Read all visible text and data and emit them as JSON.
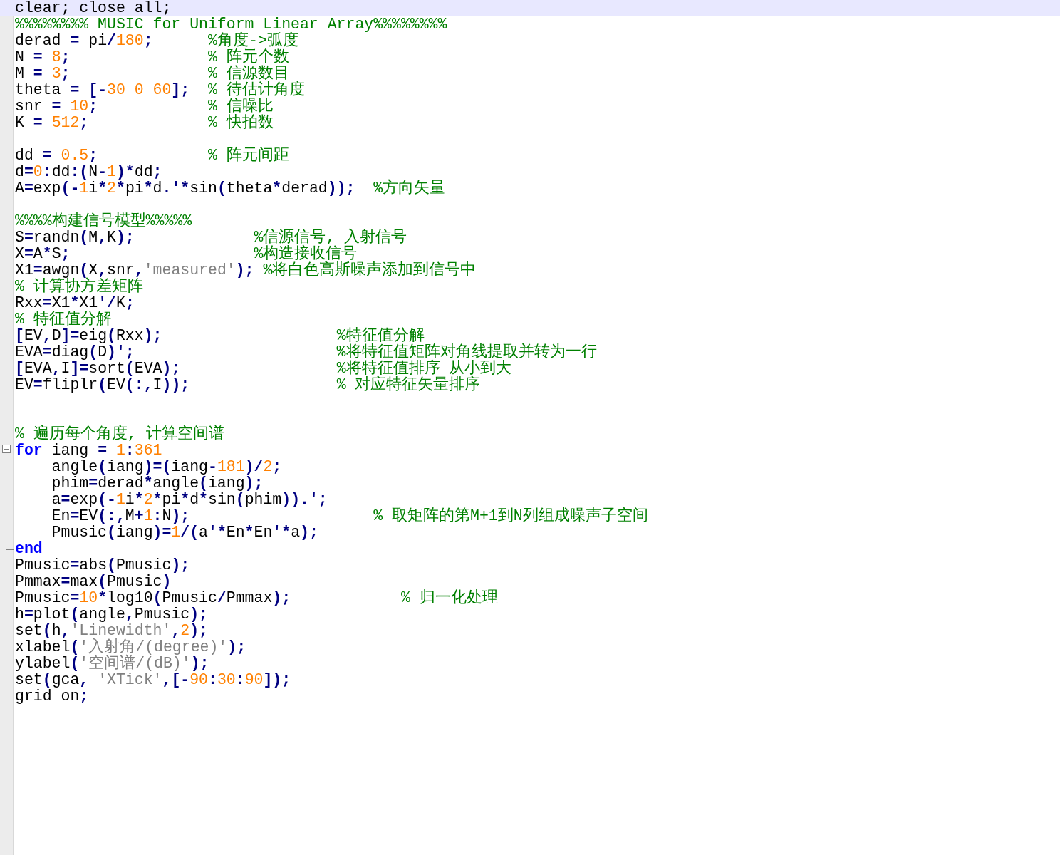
{
  "editor": {
    "lines": [
      {
        "current": true,
        "tokens": [
          {
            "kind": "plain",
            "text": "clear; close all;"
          }
        ]
      },
      {
        "current": false,
        "tokens": [
          {
            "kind": "comment",
            "text": "%%%%%%%% MUSIC for Uniform Linear Array%%%%%%%%"
          }
        ]
      },
      {
        "current": false,
        "tokens": [
          {
            "kind": "plain",
            "text": "derad "
          },
          {
            "kind": "op",
            "text": "="
          },
          {
            "kind": "plain",
            "text": " pi"
          },
          {
            "kind": "op",
            "text": "/"
          },
          {
            "kind": "num",
            "text": "180"
          },
          {
            "kind": "op",
            "text": ";      "
          },
          {
            "kind": "comment",
            "text": "%角度->弧度"
          }
        ]
      },
      {
        "current": false,
        "tokens": [
          {
            "kind": "plain",
            "text": "N "
          },
          {
            "kind": "op",
            "text": "= "
          },
          {
            "kind": "num",
            "text": "8"
          },
          {
            "kind": "op",
            "text": ";               "
          },
          {
            "kind": "comment",
            "text": "% 阵元个数"
          }
        ]
      },
      {
        "current": false,
        "tokens": [
          {
            "kind": "plain",
            "text": "M "
          },
          {
            "kind": "op",
            "text": "= "
          },
          {
            "kind": "num",
            "text": "3"
          },
          {
            "kind": "op",
            "text": ";               "
          },
          {
            "kind": "comment",
            "text": "% 信源数目"
          }
        ]
      },
      {
        "current": false,
        "tokens": [
          {
            "kind": "plain",
            "text": "theta "
          },
          {
            "kind": "op",
            "text": "= [-"
          },
          {
            "kind": "num",
            "text": "30 0 60"
          },
          {
            "kind": "op",
            "text": "];  "
          },
          {
            "kind": "comment",
            "text": "% 待估计角度"
          }
        ]
      },
      {
        "current": false,
        "tokens": [
          {
            "kind": "plain",
            "text": "snr "
          },
          {
            "kind": "op",
            "text": "= "
          },
          {
            "kind": "num",
            "text": "10"
          },
          {
            "kind": "op",
            "text": ";            "
          },
          {
            "kind": "comment",
            "text": "% 信噪比"
          }
        ]
      },
      {
        "current": false,
        "tokens": [
          {
            "kind": "plain",
            "text": "K "
          },
          {
            "kind": "op",
            "text": "= "
          },
          {
            "kind": "num",
            "text": "512"
          },
          {
            "kind": "op",
            "text": ";             "
          },
          {
            "kind": "comment",
            "text": "% 快拍数"
          }
        ]
      },
      {
        "current": false,
        "kind": "blank"
      },
      {
        "current": false,
        "tokens": [
          {
            "kind": "plain",
            "text": "dd "
          },
          {
            "kind": "op",
            "text": "= "
          },
          {
            "kind": "num",
            "text": "0.5"
          },
          {
            "kind": "op",
            "text": ";            "
          },
          {
            "kind": "comment",
            "text": "% 阵元间距"
          }
        ]
      },
      {
        "current": false,
        "tokens": [
          {
            "kind": "plain",
            "text": "d"
          },
          {
            "kind": "op",
            "text": "="
          },
          {
            "kind": "num",
            "text": "0"
          },
          {
            "kind": "op",
            "text": ":"
          },
          {
            "kind": "plain",
            "text": "dd"
          },
          {
            "kind": "op",
            "text": ":("
          },
          {
            "kind": "plain",
            "text": "N"
          },
          {
            "kind": "op",
            "text": "-"
          },
          {
            "kind": "num",
            "text": "1"
          },
          {
            "kind": "op",
            "text": ")*"
          },
          {
            "kind": "plain",
            "text": "dd"
          },
          {
            "kind": "op",
            "text": ";"
          }
        ]
      },
      {
        "current": false,
        "tokens": [
          {
            "kind": "plain",
            "text": "A"
          },
          {
            "kind": "op",
            "text": "="
          },
          {
            "kind": "plain",
            "text": "exp"
          },
          {
            "kind": "op",
            "text": "(-"
          },
          {
            "kind": "num",
            "text": "1"
          },
          {
            "kind": "plain",
            "text": "i"
          },
          {
            "kind": "op",
            "text": "*"
          },
          {
            "kind": "num",
            "text": "2"
          },
          {
            "kind": "op",
            "text": "*"
          },
          {
            "kind": "plain",
            "text": "pi"
          },
          {
            "kind": "op",
            "text": "*"
          },
          {
            "kind": "plain",
            "text": "d"
          },
          {
            "kind": "op",
            "text": ".'*"
          },
          {
            "kind": "plain",
            "text": "sin"
          },
          {
            "kind": "op",
            "text": "("
          },
          {
            "kind": "plain",
            "text": "theta"
          },
          {
            "kind": "op",
            "text": "*"
          },
          {
            "kind": "plain",
            "text": "derad"
          },
          {
            "kind": "op",
            "text": "));  "
          },
          {
            "kind": "comment",
            "text": "%方向矢量"
          }
        ]
      },
      {
        "current": false,
        "kind": "blank"
      },
      {
        "current": false,
        "tokens": [
          {
            "kind": "comment",
            "text": "%%%%构建信号模型%%%%%"
          }
        ]
      },
      {
        "current": false,
        "tokens": [
          {
            "kind": "plain",
            "text": "S"
          },
          {
            "kind": "op",
            "text": "="
          },
          {
            "kind": "plain",
            "text": "randn"
          },
          {
            "kind": "op",
            "text": "("
          },
          {
            "kind": "plain",
            "text": "M"
          },
          {
            "kind": "op",
            "text": ","
          },
          {
            "kind": "plain",
            "text": "K"
          },
          {
            "kind": "op",
            "text": ");             "
          },
          {
            "kind": "comment",
            "text": "%信源信号, 入射信号"
          }
        ]
      },
      {
        "current": false,
        "tokens": [
          {
            "kind": "plain",
            "text": "X"
          },
          {
            "kind": "op",
            "text": "="
          },
          {
            "kind": "plain",
            "text": "A"
          },
          {
            "kind": "op",
            "text": "*"
          },
          {
            "kind": "plain",
            "text": "S"
          },
          {
            "kind": "op",
            "text": ";                    "
          },
          {
            "kind": "comment",
            "text": "%构造接收信号"
          }
        ]
      },
      {
        "current": false,
        "tokens": [
          {
            "kind": "plain",
            "text": "X1"
          },
          {
            "kind": "op",
            "text": "="
          },
          {
            "kind": "plain",
            "text": "awgn"
          },
          {
            "kind": "op",
            "text": "("
          },
          {
            "kind": "plain",
            "text": "X"
          },
          {
            "kind": "op",
            "text": ","
          },
          {
            "kind": "plain",
            "text": "snr"
          },
          {
            "kind": "op",
            "text": ","
          },
          {
            "kind": "string",
            "text": "'measured'"
          },
          {
            "kind": "op",
            "text": "); "
          },
          {
            "kind": "comment",
            "text": "%将白色高斯噪声添加到信号中"
          }
        ]
      },
      {
        "current": false,
        "tokens": [
          {
            "kind": "comment",
            "text": "% 计算协方差矩阵"
          }
        ]
      },
      {
        "current": false,
        "tokens": [
          {
            "kind": "plain",
            "text": "Rxx"
          },
          {
            "kind": "op",
            "text": "="
          },
          {
            "kind": "plain",
            "text": "X1"
          },
          {
            "kind": "op",
            "text": "*"
          },
          {
            "kind": "plain",
            "text": "X1"
          },
          {
            "kind": "op",
            "text": "'/"
          },
          {
            "kind": "plain",
            "text": "K"
          },
          {
            "kind": "op",
            "text": ";"
          }
        ]
      },
      {
        "current": false,
        "tokens": [
          {
            "kind": "comment",
            "text": "% 特征值分解"
          }
        ]
      },
      {
        "current": false,
        "tokens": [
          {
            "kind": "op",
            "text": "["
          },
          {
            "kind": "plain",
            "text": "EV"
          },
          {
            "kind": "op",
            "text": ","
          },
          {
            "kind": "plain",
            "text": "D"
          },
          {
            "kind": "op",
            "text": "]="
          },
          {
            "kind": "plain",
            "text": "eig"
          },
          {
            "kind": "op",
            "text": "("
          },
          {
            "kind": "plain",
            "text": "Rxx"
          },
          {
            "kind": "op",
            "text": ");                   "
          },
          {
            "kind": "comment",
            "text": "%特征值分解"
          }
        ]
      },
      {
        "current": false,
        "tokens": [
          {
            "kind": "plain",
            "text": "EVA"
          },
          {
            "kind": "op",
            "text": "="
          },
          {
            "kind": "plain",
            "text": "diag"
          },
          {
            "kind": "op",
            "text": "("
          },
          {
            "kind": "plain",
            "text": "D"
          },
          {
            "kind": "op",
            "text": ")';                      "
          },
          {
            "kind": "comment",
            "text": "%将特征值矩阵对角线提取并转为一行"
          }
        ]
      },
      {
        "current": false,
        "tokens": [
          {
            "kind": "op",
            "text": "["
          },
          {
            "kind": "plain",
            "text": "EVA"
          },
          {
            "kind": "op",
            "text": ","
          },
          {
            "kind": "plain",
            "text": "I"
          },
          {
            "kind": "op",
            "text": "]="
          },
          {
            "kind": "plain",
            "text": "sort"
          },
          {
            "kind": "op",
            "text": "("
          },
          {
            "kind": "plain",
            "text": "EVA"
          },
          {
            "kind": "op",
            "text": ");                 "
          },
          {
            "kind": "comment",
            "text": "%将特征值排序 从小到大"
          }
        ]
      },
      {
        "current": false,
        "tokens": [
          {
            "kind": "plain",
            "text": "EV"
          },
          {
            "kind": "op",
            "text": "="
          },
          {
            "kind": "plain",
            "text": "fliplr"
          },
          {
            "kind": "op",
            "text": "("
          },
          {
            "kind": "plain",
            "text": "EV"
          },
          {
            "kind": "op",
            "text": "(:,"
          },
          {
            "kind": "plain",
            "text": "I"
          },
          {
            "kind": "op",
            "text": "));                "
          },
          {
            "kind": "comment",
            "text": "% 对应特征矢量排序"
          }
        ]
      },
      {
        "current": false,
        "kind": "blank"
      },
      {
        "current": false,
        "kind": "blank"
      },
      {
        "current": false,
        "tokens": [
          {
            "kind": "comment",
            "text": "% 遍历每个角度, 计算空间谱"
          }
        ]
      },
      {
        "current": false,
        "kind": "fold_start",
        "tokens": [
          {
            "kind": "keyword",
            "text": "for"
          },
          {
            "kind": "plain",
            "text": " iang "
          },
          {
            "kind": "op",
            "text": "= "
          },
          {
            "kind": "num",
            "text": "1"
          },
          {
            "kind": "op",
            "text": ":"
          },
          {
            "kind": "num",
            "text": "361"
          }
        ]
      },
      {
        "current": false,
        "kind": "fold_body",
        "tokens": [
          {
            "kind": "plain",
            "text": "    angle"
          },
          {
            "kind": "op",
            "text": "("
          },
          {
            "kind": "plain",
            "text": "iang"
          },
          {
            "kind": "op",
            "text": ")=("
          },
          {
            "kind": "plain",
            "text": "iang"
          },
          {
            "kind": "op",
            "text": "-"
          },
          {
            "kind": "num",
            "text": "181"
          },
          {
            "kind": "op",
            "text": ")/"
          },
          {
            "kind": "num",
            "text": "2"
          },
          {
            "kind": "op",
            "text": ";"
          }
        ]
      },
      {
        "current": false,
        "kind": "fold_body",
        "tokens": [
          {
            "kind": "plain",
            "text": "    phim"
          },
          {
            "kind": "op",
            "text": "="
          },
          {
            "kind": "plain",
            "text": "derad"
          },
          {
            "kind": "op",
            "text": "*"
          },
          {
            "kind": "plain",
            "text": "angle"
          },
          {
            "kind": "op",
            "text": "("
          },
          {
            "kind": "plain",
            "text": "iang"
          },
          {
            "kind": "op",
            "text": ");"
          }
        ]
      },
      {
        "current": false,
        "kind": "fold_body",
        "tokens": [
          {
            "kind": "plain",
            "text": "    a"
          },
          {
            "kind": "op",
            "text": "="
          },
          {
            "kind": "plain",
            "text": "exp"
          },
          {
            "kind": "op",
            "text": "(-"
          },
          {
            "kind": "num",
            "text": "1"
          },
          {
            "kind": "plain",
            "text": "i"
          },
          {
            "kind": "op",
            "text": "*"
          },
          {
            "kind": "num",
            "text": "2"
          },
          {
            "kind": "op",
            "text": "*"
          },
          {
            "kind": "plain",
            "text": "pi"
          },
          {
            "kind": "op",
            "text": "*"
          },
          {
            "kind": "plain",
            "text": "d"
          },
          {
            "kind": "op",
            "text": "*"
          },
          {
            "kind": "plain",
            "text": "sin"
          },
          {
            "kind": "op",
            "text": "("
          },
          {
            "kind": "plain",
            "text": "phim"
          },
          {
            "kind": "op",
            "text": ")).';"
          }
        ]
      },
      {
        "current": false,
        "kind": "fold_body",
        "tokens": [
          {
            "kind": "plain",
            "text": "    En"
          },
          {
            "kind": "op",
            "text": "="
          },
          {
            "kind": "plain",
            "text": "EV"
          },
          {
            "kind": "op",
            "text": "(:,"
          },
          {
            "kind": "plain",
            "text": "M"
          },
          {
            "kind": "op",
            "text": "+"
          },
          {
            "kind": "num",
            "text": "1"
          },
          {
            "kind": "op",
            "text": ":"
          },
          {
            "kind": "plain",
            "text": "N"
          },
          {
            "kind": "op",
            "text": ");                    "
          },
          {
            "kind": "comment",
            "text": "% 取矩阵的第M+1到N列组成噪声子空间"
          }
        ]
      },
      {
        "current": false,
        "kind": "fold_body",
        "tokens": [
          {
            "kind": "plain",
            "text": "    Pmusic"
          },
          {
            "kind": "op",
            "text": "("
          },
          {
            "kind": "plain",
            "text": "iang"
          },
          {
            "kind": "op",
            "text": ")="
          },
          {
            "kind": "num",
            "text": "1"
          },
          {
            "kind": "op",
            "text": "/("
          },
          {
            "kind": "plain",
            "text": "a"
          },
          {
            "kind": "op",
            "text": "'*"
          },
          {
            "kind": "plain",
            "text": "En"
          },
          {
            "kind": "op",
            "text": "*"
          },
          {
            "kind": "plain",
            "text": "En"
          },
          {
            "kind": "op",
            "text": "'*"
          },
          {
            "kind": "plain",
            "text": "a"
          },
          {
            "kind": "op",
            "text": ");"
          }
        ]
      },
      {
        "current": false,
        "kind": "fold_end",
        "tokens": [
          {
            "kind": "keyword",
            "text": "end"
          }
        ]
      },
      {
        "current": false,
        "tokens": [
          {
            "kind": "plain",
            "text": "Pmusic"
          },
          {
            "kind": "op",
            "text": "="
          },
          {
            "kind": "plain",
            "text": "abs"
          },
          {
            "kind": "op",
            "text": "("
          },
          {
            "kind": "plain",
            "text": "Pmusic"
          },
          {
            "kind": "op",
            "text": ");"
          }
        ]
      },
      {
        "current": false,
        "tokens": [
          {
            "kind": "plain",
            "text": "Pmmax"
          },
          {
            "kind": "op",
            "text": "="
          },
          {
            "kind": "plain",
            "text": "max"
          },
          {
            "kind": "op",
            "text": "("
          },
          {
            "kind": "plain",
            "text": "Pmusic"
          },
          {
            "kind": "op",
            "text": ")"
          }
        ]
      },
      {
        "current": false,
        "tokens": [
          {
            "kind": "plain",
            "text": "Pmusic"
          },
          {
            "kind": "op",
            "text": "="
          },
          {
            "kind": "num",
            "text": "10"
          },
          {
            "kind": "op",
            "text": "*"
          },
          {
            "kind": "plain",
            "text": "log10"
          },
          {
            "kind": "op",
            "text": "("
          },
          {
            "kind": "plain",
            "text": "Pmusic"
          },
          {
            "kind": "op",
            "text": "/"
          },
          {
            "kind": "plain",
            "text": "Pmmax"
          },
          {
            "kind": "op",
            "text": ");            "
          },
          {
            "kind": "comment",
            "text": "% 归一化处理"
          }
        ]
      },
      {
        "current": false,
        "tokens": [
          {
            "kind": "plain",
            "text": "h"
          },
          {
            "kind": "op",
            "text": "="
          },
          {
            "kind": "plain",
            "text": "plot"
          },
          {
            "kind": "op",
            "text": "("
          },
          {
            "kind": "plain",
            "text": "angle"
          },
          {
            "kind": "op",
            "text": ","
          },
          {
            "kind": "plain",
            "text": "Pmusic"
          },
          {
            "kind": "op",
            "text": ");"
          }
        ]
      },
      {
        "current": false,
        "tokens": [
          {
            "kind": "plain",
            "text": "set"
          },
          {
            "kind": "op",
            "text": "("
          },
          {
            "kind": "plain",
            "text": "h"
          },
          {
            "kind": "op",
            "text": ","
          },
          {
            "kind": "string",
            "text": "'Linewidth'"
          },
          {
            "kind": "op",
            "text": ","
          },
          {
            "kind": "num",
            "text": "2"
          },
          {
            "kind": "op",
            "text": ");"
          }
        ]
      },
      {
        "current": false,
        "tokens": [
          {
            "kind": "plain",
            "text": "xlabel"
          },
          {
            "kind": "op",
            "text": "("
          },
          {
            "kind": "string",
            "text": "'入射角/(degree)'"
          },
          {
            "kind": "op",
            "text": ");"
          }
        ]
      },
      {
        "current": false,
        "tokens": [
          {
            "kind": "plain",
            "text": "ylabel"
          },
          {
            "kind": "op",
            "text": "("
          },
          {
            "kind": "string",
            "text": "'空间谱/(dB)'"
          },
          {
            "kind": "op",
            "text": ");"
          }
        ]
      },
      {
        "current": false,
        "tokens": [
          {
            "kind": "plain",
            "text": "set"
          },
          {
            "kind": "op",
            "text": "("
          },
          {
            "kind": "plain",
            "text": "gca"
          },
          {
            "kind": "op",
            "text": ", "
          },
          {
            "kind": "string",
            "text": "'XTick'"
          },
          {
            "kind": "op",
            "text": ",[-"
          },
          {
            "kind": "num",
            "text": "90"
          },
          {
            "kind": "op",
            "text": ":"
          },
          {
            "kind": "num",
            "text": "30"
          },
          {
            "kind": "op",
            "text": ":"
          },
          {
            "kind": "num",
            "text": "90"
          },
          {
            "kind": "op",
            "text": "]);"
          }
        ]
      },
      {
        "current": false,
        "tokens": [
          {
            "kind": "plain",
            "text": "grid on"
          },
          {
            "kind": "op",
            "text": ";"
          }
        ]
      }
    ]
  }
}
